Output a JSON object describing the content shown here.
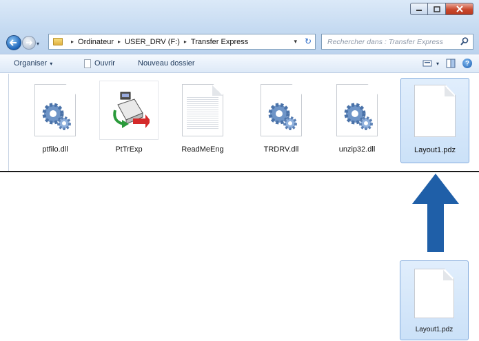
{
  "window": {
    "caption_buttons": [
      "minimize-icon",
      "maximize-icon",
      "close-icon"
    ]
  },
  "nav": {
    "back_icon": "back-arrow-icon",
    "forward_icon": "forward-arrow-icon"
  },
  "address": {
    "crumbs": [
      "Ordinateur",
      "USER_DRV (F:)",
      "Transfer Express"
    ],
    "separator": "▸",
    "dropdown": "▾",
    "refresh": "↻"
  },
  "search": {
    "placeholder": "Rechercher dans : Transfer Express"
  },
  "toolbar": {
    "organiser": "Organiser",
    "caret": "▾",
    "open": "Ouvrir",
    "new_folder": "Nouveau dossier",
    "help": "?"
  },
  "files": [
    {
      "name": "ptfilo.dll",
      "icon": "dll-gear-icon"
    },
    {
      "name": "PtTrExp",
      "icon": "transfer-app-icon"
    },
    {
      "name": "ReadMeEng",
      "icon": "text-document-icon"
    },
    {
      "name": "TRDRV.dll",
      "icon": "dll-gear-icon"
    },
    {
      "name": "unzip32.dll",
      "icon": "dll-gear-icon"
    },
    {
      "name": "Layout1.pdz",
      "icon": "blank-document-icon",
      "selected": true
    }
  ],
  "drag": {
    "name": "Layout1.pdz",
    "arrow_color": "#1f5fa8"
  }
}
